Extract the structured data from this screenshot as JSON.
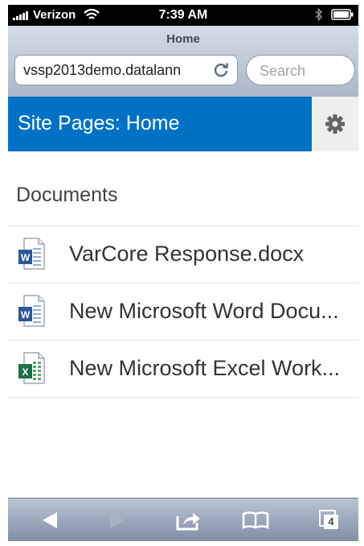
{
  "status_bar": {
    "carrier": "Verizon",
    "time": "7:39 AM"
  },
  "safari": {
    "page_title": "Home",
    "url": "vssp2013demo.datalann",
    "search_placeholder": "Search"
  },
  "site": {
    "title": "Site Pages: Home"
  },
  "documents": {
    "heading": "Documents",
    "items": [
      {
        "name": "VarCore Response.docx",
        "type": "word"
      },
      {
        "name": "New Microsoft Word Docu...",
        "type": "word"
      },
      {
        "name": "New Microsoft Excel Work...",
        "type": "excel"
      }
    ]
  },
  "toolbar": {
    "tabs_count": "4"
  },
  "colors": {
    "sharepoint_blue": "#0072c6",
    "word_blue": "#2b5797",
    "excel_green": "#1e7145"
  }
}
